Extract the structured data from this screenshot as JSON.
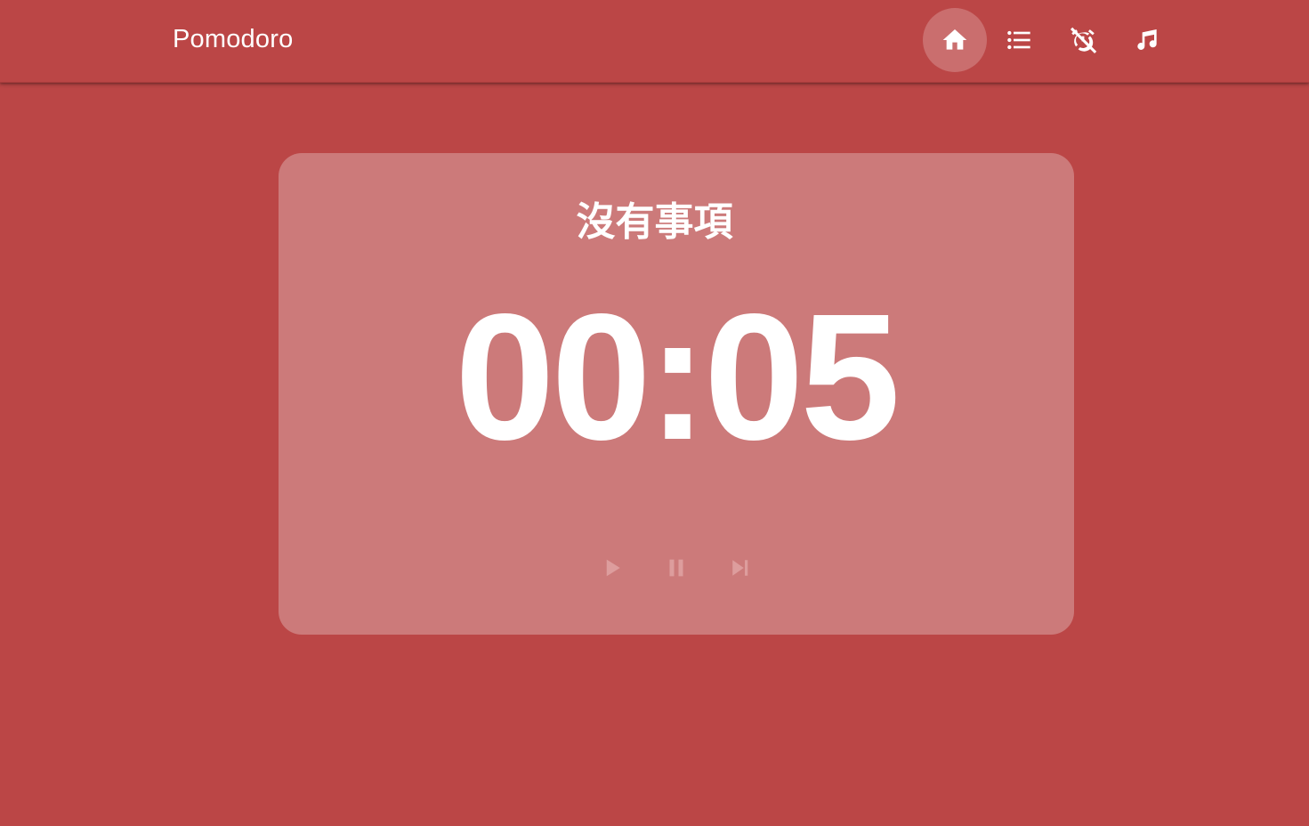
{
  "app": {
    "title": "Pomodoro"
  },
  "nav": {
    "items": [
      {
        "icon": "home-icon",
        "active": true
      },
      {
        "icon": "list-icon",
        "active": false
      },
      {
        "icon": "alarm-off-icon",
        "active": false
      },
      {
        "icon": "music-note-icon",
        "active": false
      }
    ]
  },
  "main": {
    "task_title": "沒有事項",
    "timer": "00:05"
  },
  "controls": {
    "items": [
      {
        "icon": "play-icon"
      },
      {
        "icon": "pause-icon"
      },
      {
        "icon": "skip-next-icon"
      }
    ]
  },
  "colors": {
    "background": "#bb4646",
    "card": "#cc7a7a",
    "text": "#ffffff",
    "control_disabled": "#dd9d9d"
  }
}
